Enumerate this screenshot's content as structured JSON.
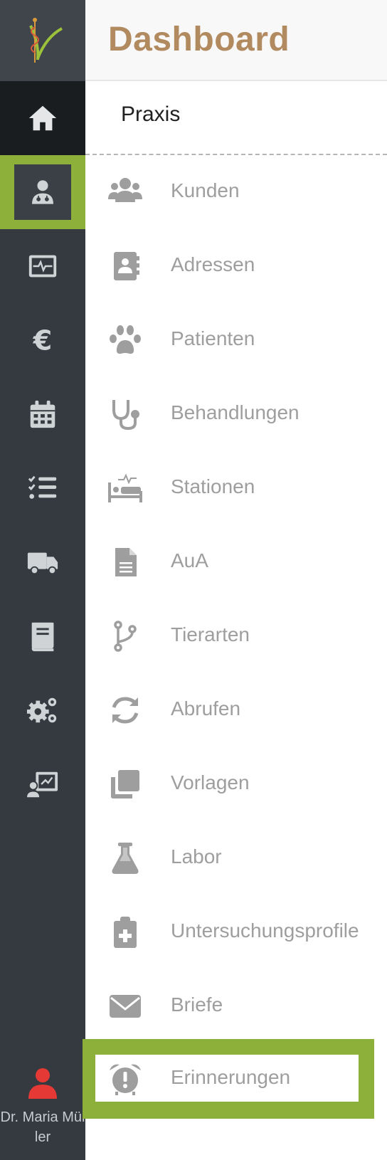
{
  "header": {
    "title": "Dashboard"
  },
  "section": {
    "label": "Praxis"
  },
  "rail": {
    "items": [
      {
        "name": "home",
        "icon": "home-icon"
      },
      {
        "name": "doctor",
        "icon": "user-doctor-icon"
      },
      {
        "name": "monitor",
        "icon": "heart-monitor-icon"
      },
      {
        "name": "finance",
        "icon": "euro-icon"
      },
      {
        "name": "calendar",
        "icon": "calendar-icon"
      },
      {
        "name": "tasks",
        "icon": "checklist-icon"
      },
      {
        "name": "delivery",
        "icon": "truck-icon"
      },
      {
        "name": "book",
        "icon": "book-icon"
      },
      {
        "name": "settings",
        "icon": "gears-icon"
      },
      {
        "name": "presentation",
        "icon": "chalkboard-user-icon"
      }
    ],
    "user": {
      "name": "Dr. Maria Müller"
    }
  },
  "menu": [
    {
      "label": "Kunden",
      "icon": "users-icon"
    },
    {
      "label": "Adressen",
      "icon": "address-book-icon"
    },
    {
      "label": "Patienten",
      "icon": "paw-icon"
    },
    {
      "label": "Behandlungen",
      "icon": "stethoscope-icon"
    },
    {
      "label": "Stationen",
      "icon": "bed-pulse-icon"
    },
    {
      "label": "AuA",
      "icon": "file-lines-icon"
    },
    {
      "label": "Tierarten",
      "icon": "code-branch-icon"
    },
    {
      "label": "Abrufen",
      "icon": "sync-icon"
    },
    {
      "label": "Vorlagen",
      "icon": "clone-icon"
    },
    {
      "label": "Labor",
      "icon": "flask-icon"
    },
    {
      "label": "Untersuchungsprofile",
      "icon": "clipboard-plus-icon"
    },
    {
      "label": "Briefe",
      "icon": "envelope-icon"
    },
    {
      "label": "Erinnerungen",
      "icon": "alarm-clock-icon"
    }
  ],
  "colors": {
    "rail_bg": "#343a40",
    "accent_green": "#8cb03a",
    "title_brown": "#b18a60",
    "menu_gray": "#9e9e9e",
    "user_red": "#e53935"
  }
}
